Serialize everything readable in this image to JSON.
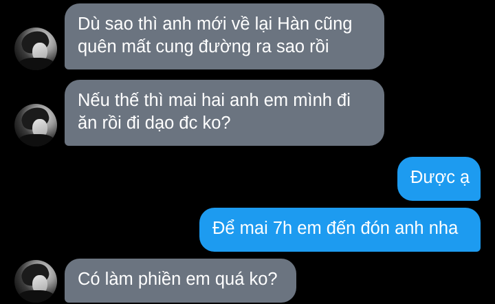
{
  "messages": [
    {
      "direction": "incoming",
      "lines": [
        "Dù sao thì anh mới về lại Hàn cũng",
        "quên mất cung đường ra sao rồi"
      ]
    },
    {
      "direction": "incoming",
      "lines": [
        "Nếu thế thì mai hai anh em mình đi",
        "ăn rồi đi dạo đc ko?"
      ]
    },
    {
      "direction": "outgoing",
      "lines": [
        "Được ạ"
      ]
    },
    {
      "direction": "outgoing",
      "lines": [
        "Để mai 7h em đến đón anh nha"
      ]
    },
    {
      "direction": "incoming",
      "lines": [
        "Có làm phiền em quá ko?"
      ]
    }
  ],
  "colors": {
    "background": "#000000",
    "incoming_bubble": "#6b7480",
    "outgoing_bubble": "#1d9bf0",
    "text": "#ffffff"
  },
  "icons": {
    "contact_avatar": "avatar-photo"
  }
}
